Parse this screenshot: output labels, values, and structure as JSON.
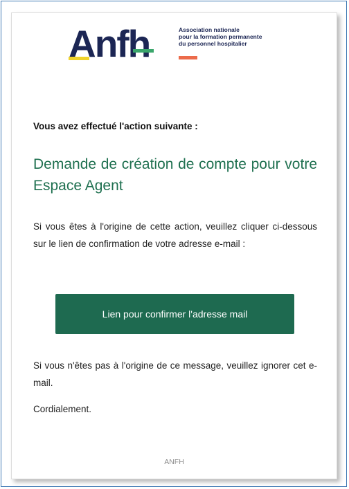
{
  "logo": {
    "word": "Anfh",
    "tagline": [
      "Association nationale",
      "pour la formation permanente",
      "du personnel hospitalier"
    ],
    "colors": {
      "navy": "#1c2654",
      "yellow": "#f0d32a",
      "green": "#3aa66b",
      "orange": "#ec6b4b"
    }
  },
  "email": {
    "intro": "Vous avez effectué l'action suivante :",
    "headline": "Demande de création de compte pour votre Espace Agent",
    "instruction": "Si vous êtes à l'origine de cette action, veuillez cliquer ci-dessous sur le lien de confirmation de votre adresse e-mail :",
    "cta_label": "Lien pour confirmer l'adresse mail",
    "ignore_notice": "Si vous n'êtes pas à l'origine de ce message, veuillez ignorer cet e-mail.",
    "closing": "Cordialement.",
    "footer": "ANFH"
  },
  "colors": {
    "accent": "#1e6a50",
    "headline": "#1f7050",
    "frame_border": "#3f79b4"
  }
}
